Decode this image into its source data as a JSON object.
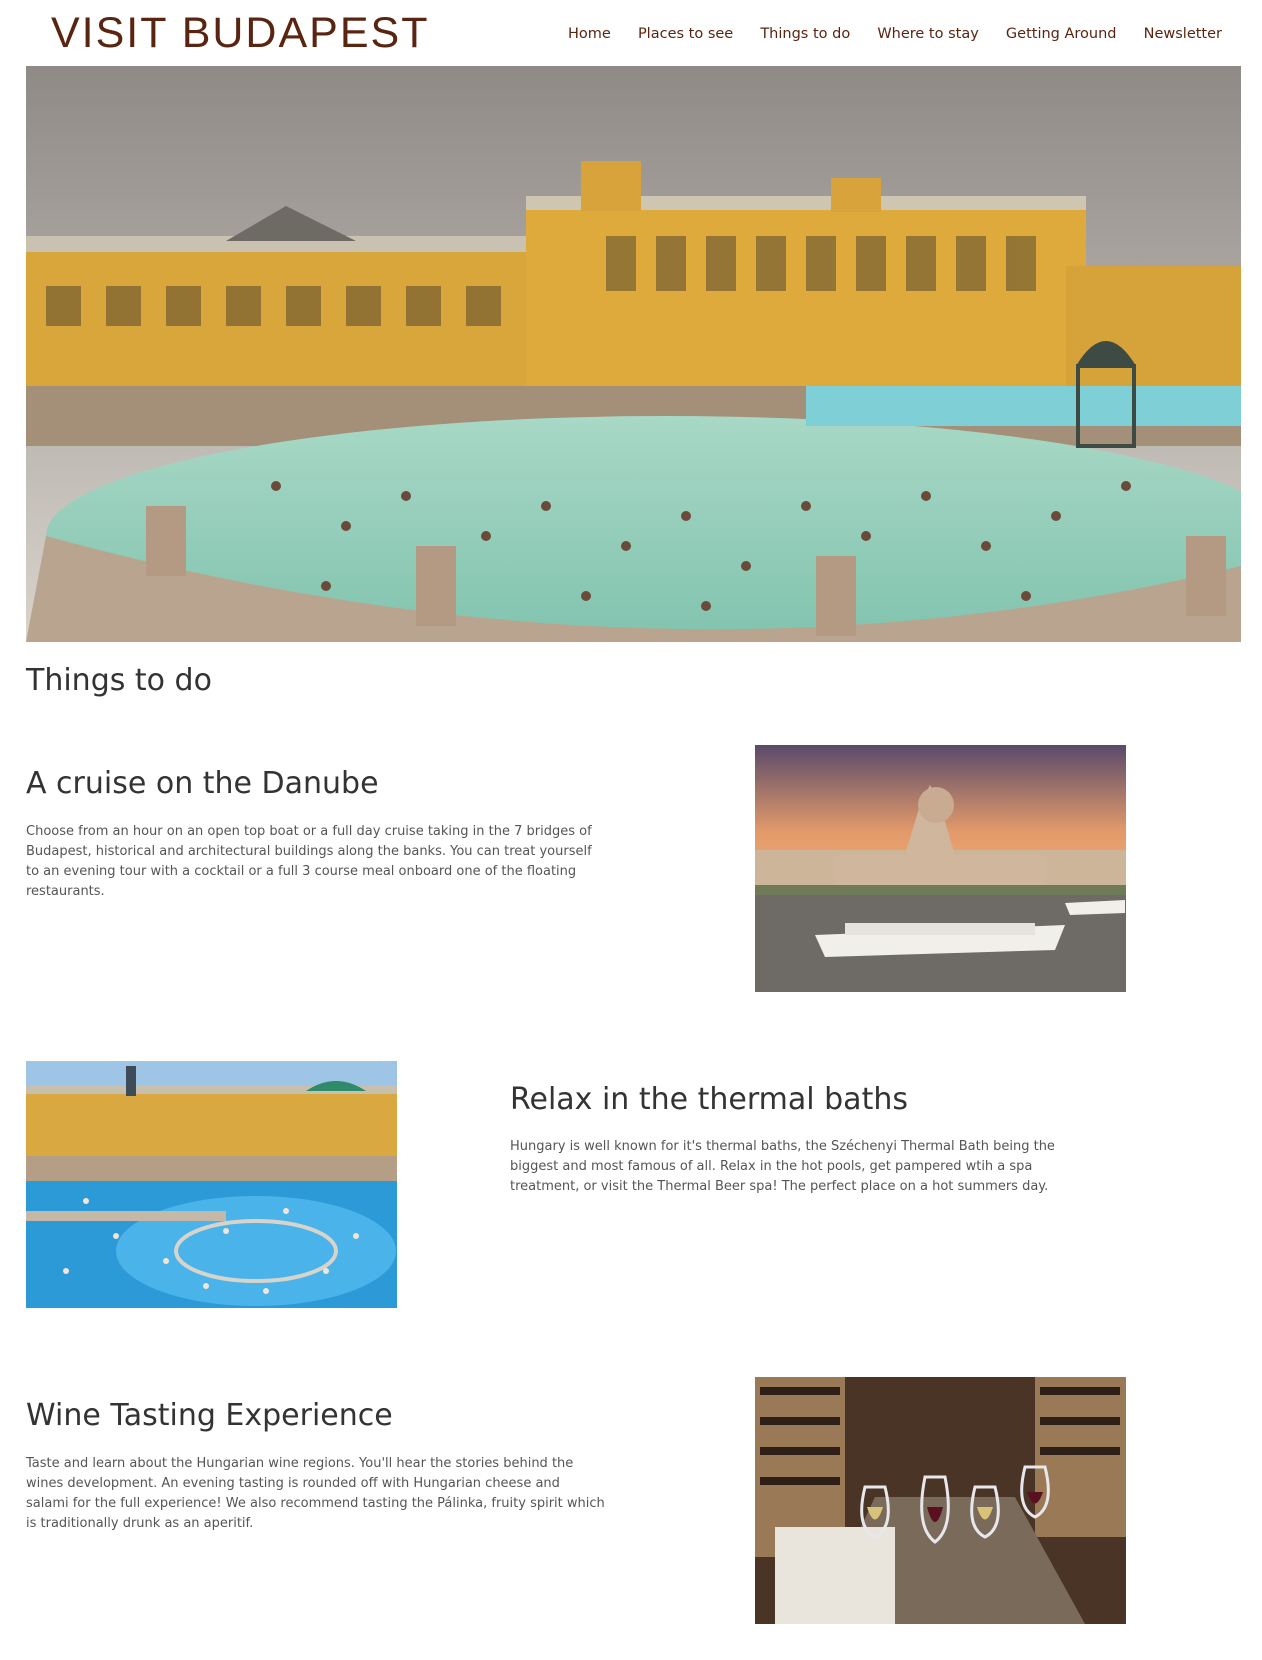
{
  "header": {
    "brand": "VISIT BUDAPEST",
    "nav": [
      {
        "label": "Home"
      },
      {
        "label": "Places to see"
      },
      {
        "label": "Things to do"
      },
      {
        "label": "Where to stay"
      },
      {
        "label": "Getting Around"
      },
      {
        "label": "Newsletter"
      }
    ]
  },
  "main": {
    "heading": "Things to do",
    "sections": [
      {
        "title": "A cruise on the Danube",
        "text": "Choose from an hour on an open top boat or a full day cruise taking in the 7 bridges of Budapest, historical and architectural buildings along the banks. You can treat yourself to an evening tour with a cocktail or a full 3 course meal onboard one of the floating restaurants."
      },
      {
        "title": "Relax in the thermal baths",
        "text": "Hungary is well known for it's thermal baths, the Széchenyi Thermal Bath being the biggest and most famous of all. Relax in the hot pools, get pampered wtih a spa treatment, or visit the Thermal Beer spa! The perfect place on a hot summers day."
      },
      {
        "title": "Wine Tasting Experience",
        "text": "Taste and learn about the Hungarian wine regions. You'll hear the stories behind the wines development. An evening tasting is rounded off with Hungarian cheese and salami for the full experience! We also recommend tasting the Pálinka, fruity spirit which is traditionally drunk as an aperitif."
      }
    ]
  },
  "colors": {
    "brand": "#5a2510",
    "text": "#333333",
    "body_text": "#555555"
  }
}
